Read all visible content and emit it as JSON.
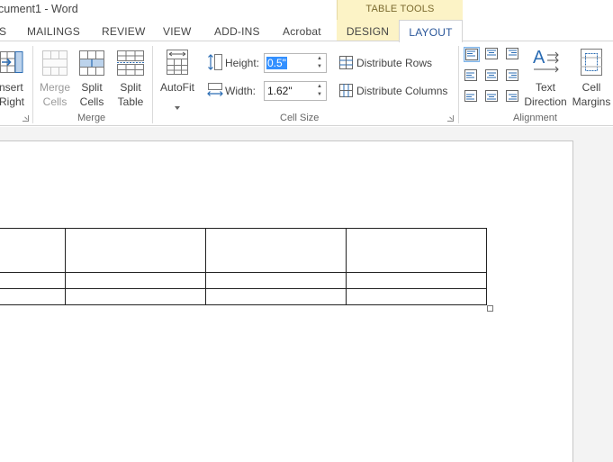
{
  "window": {
    "title": "cument1 - Word",
    "context_tab_group": "TABLE TOOLS"
  },
  "tabs": [
    {
      "label": "S"
    },
    {
      "label": "MAILINGS"
    },
    {
      "label": "REVIEW"
    },
    {
      "label": "VIEW"
    },
    {
      "label": "ADD-INS"
    },
    {
      "label": "Acrobat"
    },
    {
      "label": "DESIGN"
    },
    {
      "label": "LAYOUT",
      "active": true
    }
  ],
  "ribbon": {
    "insert_right": {
      "line1": "nsert",
      "line2": "Right"
    },
    "merge": {
      "group_label": "Merge",
      "merge_cells": {
        "line1": "Merge",
        "line2": "Cells",
        "enabled": false
      },
      "split_cells": {
        "line1": "Split",
        "line2": "Cells"
      },
      "split_table": {
        "line1": "Split",
        "line2": "Table"
      }
    },
    "autofit": {
      "label": "AutoFit"
    },
    "cell_size": {
      "group_label": "Cell Size",
      "height_label": "Height:",
      "height_value": "0.5\"",
      "width_label": "Width:",
      "width_value": "1.62\"",
      "distribute_rows": "Distribute Rows",
      "distribute_columns": "Distribute Columns"
    },
    "alignment": {
      "group_label": "Alignment",
      "text_direction": {
        "line1": "Text",
        "line2": "Direction"
      },
      "cell_margins": {
        "line1": "Cell",
        "line2": "Margins"
      },
      "selected_alignment": "align-top-left"
    }
  },
  "table": {
    "rows": 3,
    "columns": 4
  },
  "colors": {
    "context_tab_bg": "#fcf3c6",
    "active_tab_text": "#2b579a",
    "selection_highlight": "#3390ff"
  }
}
